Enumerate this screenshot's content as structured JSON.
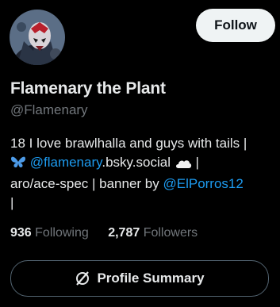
{
  "profile": {
    "display_name": "Flamenary the Plant",
    "handle": "@Flamenary",
    "follow_label": "Follow"
  },
  "bio": {
    "line1": "18 I love brawlhalla and guys with tails |",
    "bluesky_icon": "butterfly-icon",
    "link_handle": "@flamenary",
    "link_domain": ".bsky.social",
    "cloud_icon": "cloud-icon",
    "after_cloud": " |",
    "line3_prefix": "aro/ace-spec | banner by ",
    "banner_link": "@ElPorros12",
    "line4": "|"
  },
  "stats": {
    "following_count": "936",
    "following_label": "Following",
    "followers_count": "2,787",
    "followers_label": "Followers"
  },
  "summary_button": {
    "label": "Profile Summary",
    "icon": "grok-icon"
  },
  "colors": {
    "background": "#000000",
    "text": "#e7e9ea",
    "muted": "#71767b",
    "link": "#1d9bf0",
    "button_bg": "#eff3f4"
  }
}
